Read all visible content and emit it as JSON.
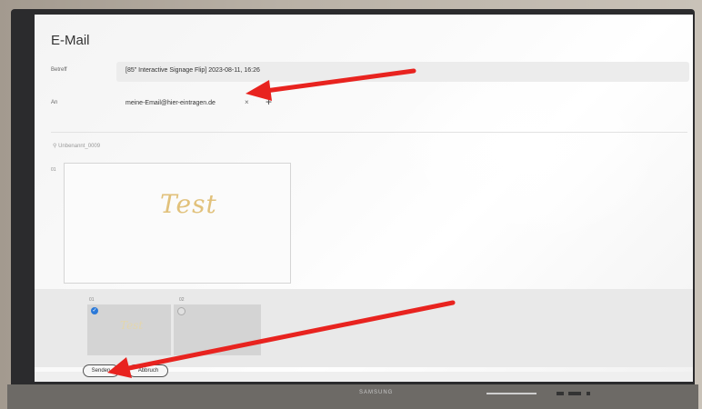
{
  "window": {
    "title": "E-Mail",
    "brand": "SAMSUNG"
  },
  "fields": {
    "subject_label": "Betreff",
    "subject_value": "[85\" Interactive Signage Flip] 2023-08-11, 16:26",
    "to_label": "An",
    "to_value": "meine-Email@hier-eintragen.de",
    "remove_symbol": "×",
    "add_symbol": "+"
  },
  "document": {
    "name": "Unbenannt_0009",
    "page_label": "01",
    "preview_text": "Test"
  },
  "thumbnails": [
    {
      "number": "01",
      "text": "Test",
      "selected": true
    },
    {
      "number": "02",
      "text": "",
      "selected": false
    }
  ],
  "buttons": {
    "send": "Senden",
    "cancel": "Abbruch"
  },
  "colors": {
    "annotation_arrow": "#e8231f",
    "check": "#2b79d8",
    "handwriting": "#e1c17b"
  }
}
